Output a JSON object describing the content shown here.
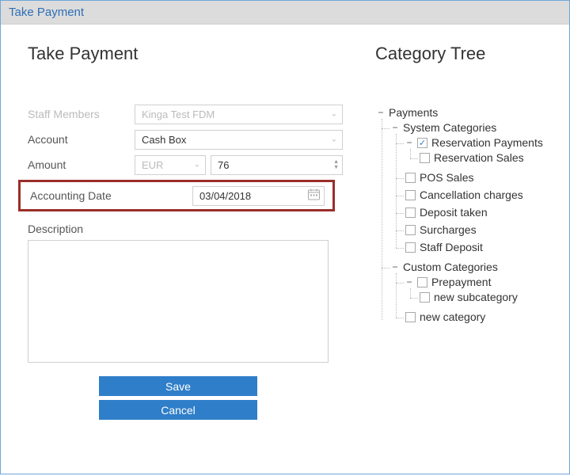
{
  "window": {
    "title": "Take Payment"
  },
  "left": {
    "heading": "Take Payment",
    "labels": {
      "staff": "Staff Members",
      "account": "Account",
      "amount": "Amount",
      "accounting_date": "Accounting Date",
      "description": "Description"
    },
    "fields": {
      "staff_value": "Kinga Test FDM",
      "account_value": "Cash Box",
      "currency_value": "EUR",
      "amount_value": "76",
      "date_value": "03/04/2018",
      "description_value": ""
    },
    "buttons": {
      "save": "Save",
      "cancel": "Cancel"
    }
  },
  "right": {
    "heading": "Category Tree",
    "tree": {
      "payments": "Payments",
      "system_categories": "System Categories",
      "reservation_payments": "Reservation Payments",
      "reservation_sales": "Reservation Sales",
      "pos_sales": "POS Sales",
      "cancellation_charges": "Cancellation charges",
      "deposit_taken": "Deposit taken",
      "surcharges": "Surcharges",
      "staff_deposit": "Staff Deposit",
      "custom_categories": "Custom Categories",
      "prepayment": "Prepayment",
      "new_subcategory": "new subcategory",
      "new_category": "new category"
    },
    "checked": {
      "reservation_payments": true
    }
  }
}
